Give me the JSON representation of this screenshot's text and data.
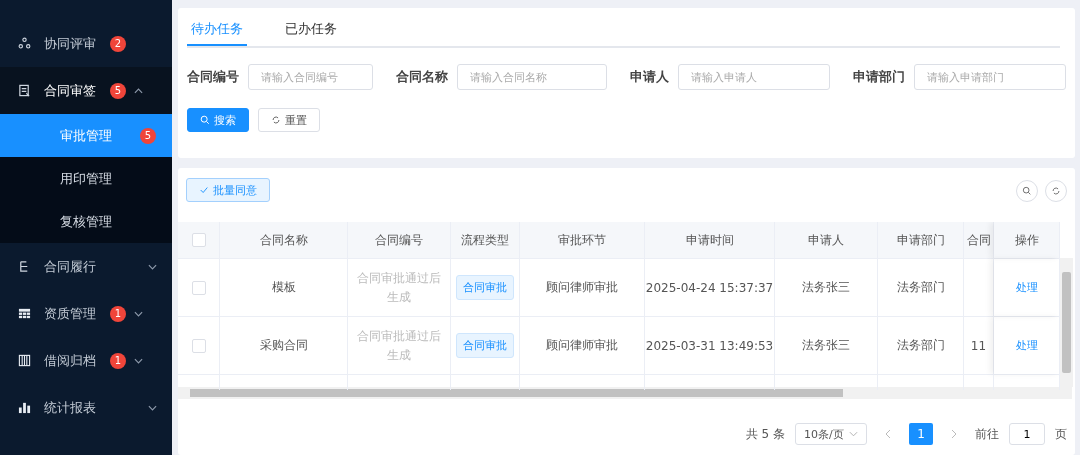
{
  "sidebar": {
    "items": [
      {
        "label": "协同评审",
        "badge": "2"
      },
      {
        "label": "合同审签",
        "badge": "5",
        "expanded": true,
        "children": [
          {
            "label": "审批管理",
            "badge": "5",
            "selected": true
          },
          {
            "label": "用印管理",
            "selected": false
          },
          {
            "label": "复核管理",
            "selected": false
          }
        ]
      },
      {
        "label": "合同履行",
        "expanded": false
      },
      {
        "label": "资质管理",
        "badge": "1",
        "expanded": false
      },
      {
        "label": "借阅归档",
        "badge": "1",
        "expanded": false
      },
      {
        "label": "统计报表",
        "expanded": false
      }
    ]
  },
  "tabs": [
    {
      "label": "待办任务",
      "selected": true
    },
    {
      "label": "已办任务",
      "selected": false
    }
  ],
  "filters": [
    {
      "label": "合同编号",
      "placeholder": "请输入合同编号"
    },
    {
      "label": "合同名称",
      "placeholder": "请输入合同名称"
    },
    {
      "label": "申请人",
      "placeholder": "请输入申请人"
    },
    {
      "label": "申请部门",
      "placeholder": "请输入申请部门"
    }
  ],
  "search_button": "搜索",
  "reset_button": "重置",
  "batch_button": "批量同意",
  "table": {
    "select_all_checked": false,
    "columns": [
      "合同名称",
      "合同编号",
      "流程类型",
      "审批环节",
      "申请时间",
      "申请人",
      "申请部门",
      "合同",
      "操作"
    ],
    "rows": [
      {
        "checked": false,
        "cells": [
          "模板",
          "合同审批通过后生成",
          "合同审批",
          "顾问律师审批",
          "2025-04-24 15:37:37",
          "法务张三",
          "法务部门",
          "",
          "处理"
        ]
      },
      {
        "checked": false,
        "cells": [
          "采购合同",
          "合同审批通过后生成",
          "合同审批",
          "顾问律师审批",
          "2025-03-31 13:49:53",
          "法务张三",
          "法务部门",
          "11",
          "处理"
        ]
      }
    ]
  },
  "pagination": {
    "total": "共 5 条",
    "page_size": "10条/页",
    "pages": [
      {
        "label": "1",
        "selected": true
      }
    ],
    "goto_label": "前往",
    "goto_value": "1",
    "page_suffix": "页"
  }
}
